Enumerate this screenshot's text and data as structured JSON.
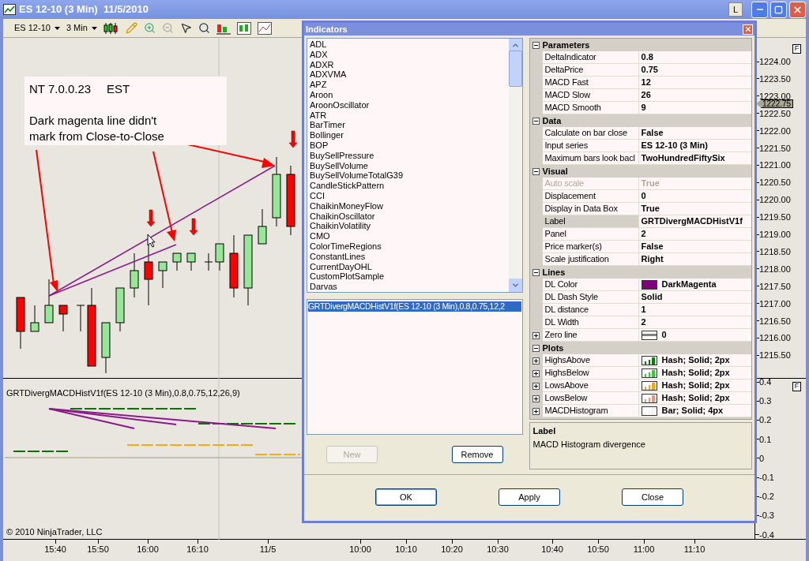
{
  "window": {
    "title": "ES 12-10 (3 Min)  11/5/2010",
    "badge": "L"
  },
  "toolbar": {
    "instrument": "ES 12-10",
    "interval": "3 Min"
  },
  "chart": {
    "note_title": [
      "NT 7.0.0.23",
      "EST"
    ],
    "note_lines": [
      "Dark magenta line didn't",
      "mark from Close-to-Close"
    ],
    "price_ticks": [
      "1224.00",
      "1223.50",
      "1223.00",
      "1222.50",
      "1222.00",
      "1221.50",
      "1221.00",
      "1220.50",
      "1220.00",
      "1219.50",
      "1219.00",
      "1218.50",
      "1218.00",
      "1217.50",
      "1217.00",
      "1216.50",
      "1216.00",
      "1215.50"
    ],
    "current_price": "1222.75",
    "scale_button": "F",
    "indicator_label": "GRTDivergMACDHistV1f(ES 12-10 (3 Min),0.8,0.75,12,26,9)",
    "indicator_ticks": [
      "0.4",
      "0.3",
      "0.2",
      "0.1",
      "0",
      "-0.1",
      "-0.2",
      "-0.3",
      "-0.4"
    ],
    "indicator_scale_button": "F",
    "time_labels": [
      "15:40",
      "15:50",
      "16:00",
      "16:10",
      "11/5",
      "10:00",
      "10:10",
      "10:20",
      "10:30",
      "10:40",
      "10:50",
      "11:00",
      "11:10"
    ],
    "copyright": "© 2010 NinjaTrader, LLC"
  },
  "dialog": {
    "title": "Indicators",
    "available": [
      {
        "label": "ADL",
        "selected": false
      },
      {
        "label": "ADX",
        "selected": false
      },
      {
        "label": "ADXR",
        "selected": false
      },
      {
        "label": "ADXVMA",
        "selected": false
      },
      {
        "label": "APZ",
        "selected": false
      },
      {
        "label": "Aroon",
        "selected": false
      },
      {
        "label": "AroonOscillator",
        "selected": false
      },
      {
        "label": "ATR",
        "selected": false
      },
      {
        "label": "BarTimer",
        "selected": false
      },
      {
        "label": "Bollinger",
        "selected": false
      },
      {
        "label": "BOP",
        "selected": false
      },
      {
        "label": "BuySellPressure",
        "selected": false
      },
      {
        "label": "BuySellVolume",
        "selected": false
      },
      {
        "label": "BuySellVolumeTotalG39",
        "selected": false
      },
      {
        "label": "CandleStickPattern",
        "selected": false
      },
      {
        "label": "CCI",
        "selected": false
      },
      {
        "label": "ChaikinMoneyFlow",
        "selected": false
      },
      {
        "label": "ChaikinOscillator",
        "selected": false
      },
      {
        "label": "ChaikinVolatility",
        "selected": false
      },
      {
        "label": "CMO",
        "selected": false
      },
      {
        "label": "ColorTimeRegions",
        "selected": false
      },
      {
        "label": "ConstantLines",
        "selected": false
      },
      {
        "label": "CurrentDayOHL",
        "selected": false
      },
      {
        "label": "CustomPlotSample",
        "selected": false
      },
      {
        "label": "Darvas",
        "selected": false
      }
    ],
    "applied": [
      {
        "label": "GRTDivergMACDHistV1f(ES 12-10 (3 Min),0.8,0.75,12,2",
        "selected": true
      }
    ],
    "new_button": {
      "label": "New",
      "disabled": true
    },
    "remove_button": {
      "label": "Remove",
      "disabled": false
    },
    "properties": [
      {
        "category": "Parameters",
        "expanded": true,
        "rows": [
          {
            "name": "DeltaIndicator",
            "value": "0.8",
            "selected": false,
            "disabled": false
          },
          {
            "name": "DeltaPrice",
            "value": "0.75",
            "selected": false,
            "disabled": false
          },
          {
            "name": "MACD Fast",
            "value": "12",
            "selected": false,
            "disabled": false
          },
          {
            "name": "MACD Slow",
            "value": "26",
            "selected": false,
            "disabled": false
          },
          {
            "name": "MACD Smooth",
            "value": "9",
            "selected": false,
            "disabled": false
          }
        ]
      },
      {
        "category": "Data",
        "expanded": true,
        "rows": [
          {
            "name": "Calculate on bar close",
            "value": "False",
            "selected": false,
            "disabled": false
          },
          {
            "name": "Input series",
            "value": "ES 12-10 (3 Min)",
            "selected": false,
            "disabled": false
          },
          {
            "name": "Maximum bars look bacl",
            "value": "TwoHundredFiftySix",
            "selected": false,
            "disabled": false
          }
        ]
      },
      {
        "category": "Visual",
        "expanded": true,
        "rows": [
          {
            "name": "Auto scale",
            "value": "True",
            "selected": false,
            "disabled": true
          },
          {
            "name": "Displacement",
            "value": "0",
            "selected": false,
            "disabled": false
          },
          {
            "name": "Display in Data Box",
            "value": "True",
            "selected": false,
            "disabled": false
          },
          {
            "name": "Label",
            "value": "GRTDivergMACDHistV1f",
            "selected": true,
            "disabled": false
          },
          {
            "name": "Panel",
            "value": "2",
            "selected": false,
            "disabled": false
          },
          {
            "name": "Price marker(s)",
            "value": "False",
            "selected": false,
            "disabled": false
          },
          {
            "name": "Scale justification",
            "value": "Right",
            "selected": false,
            "disabled": false
          }
        ]
      },
      {
        "category": "Lines",
        "expanded": true,
        "rows": [
          {
            "name": "DL Color",
            "value": "DarkMagenta",
            "selected": false,
            "disabled": false,
            "swatch": {
              "kind": "fill",
              "color": "#800080"
            }
          },
          {
            "name": "DL Dash Style",
            "value": "Solid",
            "selected": false,
            "disabled": false
          },
          {
            "name": "DL distance",
            "value": "1",
            "selected": false,
            "disabled": false
          },
          {
            "name": "DL Width",
            "value": "2",
            "selected": false,
            "disabled": false
          },
          {
            "name": "Zero line",
            "value": "0",
            "selected": false,
            "disabled": false,
            "expanded": false,
            "swatch": {
              "kind": "line",
              "color": "#808080"
            }
          }
        ]
      },
      {
        "category": "Plots",
        "expanded": true,
        "rows": [
          {
            "name": "HighsAbove",
            "value": "Hash; Solid; 2px",
            "selected": false,
            "disabled": false,
            "expanded": false,
            "swatch": {
              "kind": "bars",
              "color": "#008000"
            }
          },
          {
            "name": "HighsBelow",
            "value": "Hash; Solid; 2px",
            "selected": false,
            "disabled": false,
            "expanded": false,
            "swatch": {
              "kind": "bars",
              "color": "#32cd32"
            }
          },
          {
            "name": "LowsAbove",
            "value": "Hash; Solid; 2px",
            "selected": false,
            "disabled": false,
            "expanded": false,
            "swatch": {
              "kind": "bars",
              "color": "#ffa500"
            }
          },
          {
            "name": "LowsBelow",
            "value": "Hash; Solid; 2px",
            "selected": false,
            "disabled": false,
            "expanded": false,
            "swatch": {
              "kind": "bars",
              "color": "#e9967a"
            }
          },
          {
            "name": "MACDHistogram",
            "value": "Bar; Solid; 4px",
            "selected": false,
            "disabled": false,
            "expanded": false,
            "swatch": {
              "kind": "bars",
              "color": "#f5f5f5"
            }
          }
        ]
      }
    ],
    "description": {
      "title": "Label",
      "text": "MACD Histogram divergence"
    },
    "footer_buttons": [
      "OK",
      "Apply",
      "Close"
    ]
  }
}
